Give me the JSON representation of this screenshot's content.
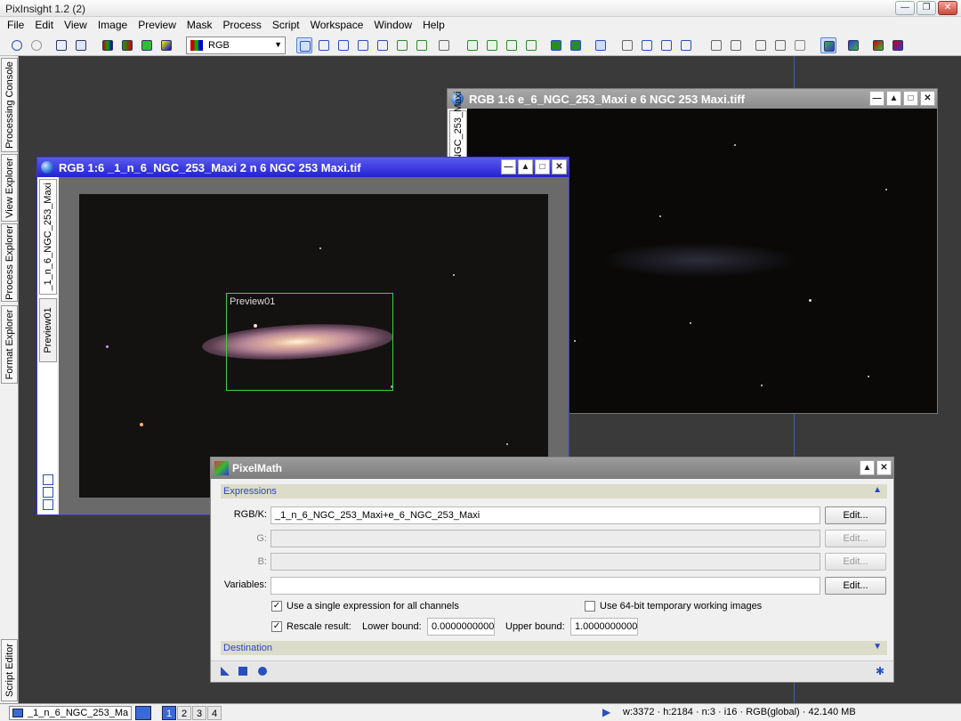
{
  "app": {
    "title": "PixInsight 1.2 (2)"
  },
  "menu": [
    "File",
    "Edit",
    "View",
    "Image",
    "Preview",
    "Mask",
    "Process",
    "Script",
    "Workspace",
    "Window",
    "Help"
  ],
  "toolbar": {
    "color_mode": "RGB"
  },
  "side_tabs": [
    "Processing Console",
    "View Explorer",
    "Process Explorer",
    "Format Explorer",
    "Script Editor"
  ],
  "window1": {
    "title": "RGB 1:6 _1_n_6_NGC_253_Maxi 2 n 6 NGC 253 Maxi.tif",
    "tab_main": "_1_n_6_NGC_253_Maxi",
    "tab_preview": "Preview01",
    "preview_label": "Preview01"
  },
  "window2": {
    "title": "RGB 1:6 e_6_NGC_253_Maxi e 6 NGC 253 Maxi.tiff",
    "tab_main": "e_6_NGC_253_Maxi"
  },
  "pixelmath": {
    "title": "PixelMath",
    "expressions_label": "Expressions",
    "rgbk_label": "RGB/K:",
    "rgbk_value": "_1_n_6_NGC_253_Maxi+e_6_NGC_253_Maxi",
    "g_label": "G:",
    "b_label": "B:",
    "variables_label": "Variables:",
    "edit_label": "Edit...",
    "single_expression_label": "Use a single expression for all channels",
    "single_expression_checked": true,
    "temp64_label": "Use 64-bit temporary working images",
    "temp64_checked": false,
    "rescale_label": "Rescale result:",
    "rescale_checked": true,
    "lower_bound_label": "Lower bound:",
    "lower_bound_value": "0.0000000000",
    "upper_bound_label": "Upper bound:",
    "upper_bound_value": "1.0000000000",
    "destination_label": "Destination"
  },
  "status": {
    "view": "_1_n_6_NGC_253_Ma",
    "workspaces": [
      "1",
      "2",
      "3",
      "4"
    ],
    "active_workspace": "1",
    "info": "w:3372 · h:2184 · n:3 · i16 · RGB(global) · 42.140 MB"
  }
}
